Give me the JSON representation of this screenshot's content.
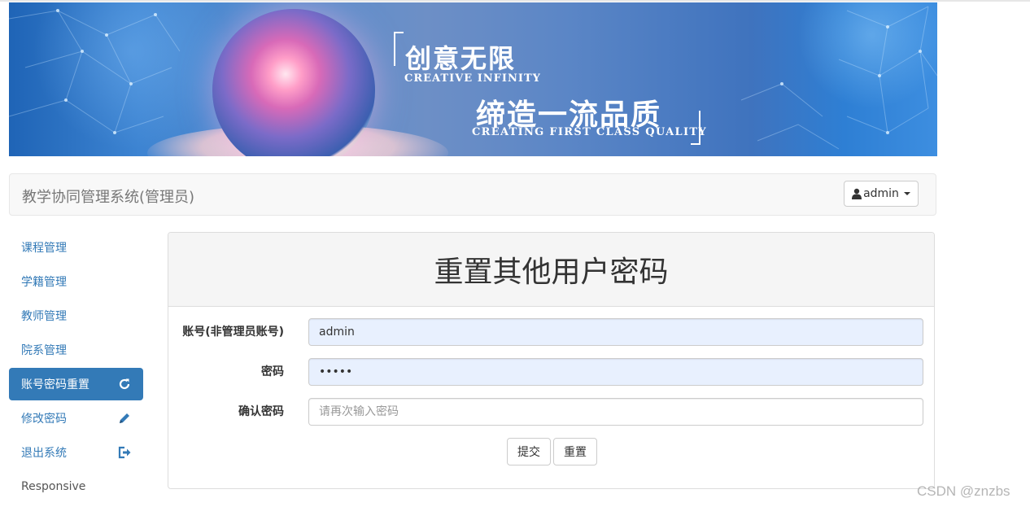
{
  "banner": {
    "headline_cn": "创意无限",
    "headline_en": "CREATIVE INFINITY",
    "tagline_cn": "缔造一流品质",
    "tagline_en": "CREATING FIRST CLASS QUALITY"
  },
  "navbar": {
    "brand": "教学协同管理系统(管理员)",
    "user_label": "admin",
    "user_icon": "user-icon"
  },
  "sidebar": {
    "items": [
      {
        "label": "课程管理",
        "icon": null,
        "active": false
      },
      {
        "label": "学籍管理",
        "icon": null,
        "active": false
      },
      {
        "label": "教师管理",
        "icon": null,
        "active": false
      },
      {
        "label": "院系管理",
        "icon": null,
        "active": false
      },
      {
        "label": "账号密码重置",
        "icon": "refresh-icon",
        "active": true
      },
      {
        "label": "修改密码",
        "icon": "pencil-icon",
        "active": false
      },
      {
        "label": "退出系统",
        "icon": "logout-icon",
        "active": false
      },
      {
        "label": "Responsive",
        "icon": null,
        "active": false
      }
    ]
  },
  "form": {
    "title": "重置其他用户密码",
    "account_label": "账号(非管理员账号)",
    "account_value": "admin",
    "password_label": "密码",
    "password_value": "•••••",
    "confirm_label": "确认密码",
    "confirm_placeholder": "请再次输入密码",
    "submit_label": "提交",
    "reset_label": "重置"
  },
  "watermark": "CSDN @znzbs",
  "colors": {
    "primary": "#337ab7",
    "navbar_bg": "#f8f8f8",
    "autofill_bg": "#e8f0fe"
  }
}
